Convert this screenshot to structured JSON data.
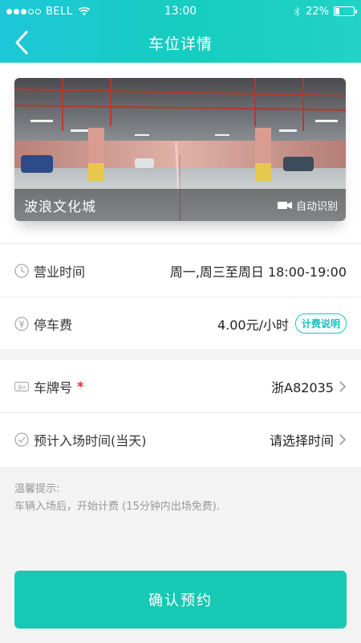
{
  "status_bar": {
    "carrier": "BELL",
    "time": "13:00",
    "battery_label": "22%",
    "battery_level": 0.22
  },
  "nav": {
    "title": "车位详情",
    "back_icon": "chevron-left-icon"
  },
  "parking_lot": {
    "name": "波浪文化城",
    "auto_recognition_label": "自动识别",
    "camera_icon": "camera-icon"
  },
  "info": {
    "hours_label": "营业时间",
    "hours_value": "周一,周三至周日 18:00-19:00",
    "fee_label": "停车费",
    "fee_value": "4.00元/小时",
    "fee_explain_label": "计费说明"
  },
  "booking": {
    "plate_label": "车牌号",
    "plate_required_mark": "*",
    "plate_icon_text": "浙A",
    "plate_value": "浙A82035",
    "entry_time_label": "预计入场时间(当天)",
    "entry_time_value": "请选择时间"
  },
  "tips": {
    "title": "温馨提示:",
    "text": "车辆入场后，开始计费 (15分钟内出场免费)."
  },
  "confirm_label": "确认预约",
  "colors": {
    "accent": "#16c9b4",
    "header_gradient_start": "#1ec7d8",
    "header_gradient_end": "#22d2c6",
    "required": "#e52b2b"
  }
}
